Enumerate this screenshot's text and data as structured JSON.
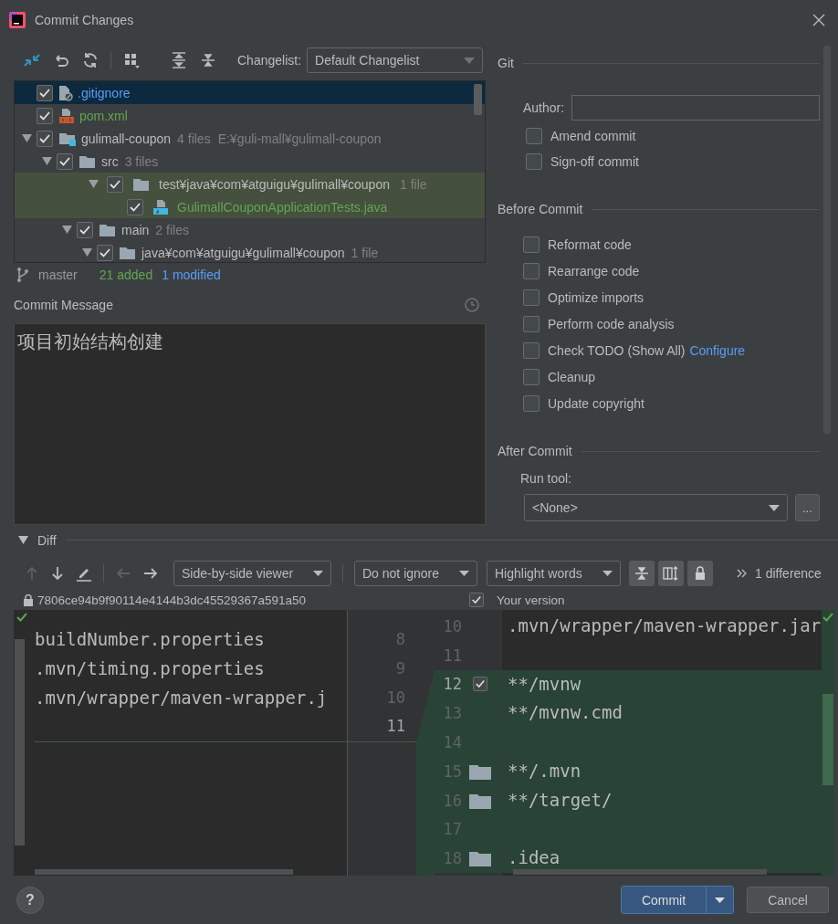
{
  "window": {
    "title": "Commit Changes"
  },
  "changes": {
    "changelist_label": "Changelist:",
    "changelist": "Default Changelist",
    "tree": [
      {
        "kind": "ignore-file",
        "name": ".gitignore",
        "color": "#589df6",
        "checked": true,
        "selected": true,
        "highlighted": false
      },
      {
        "kind": "xml-file",
        "name": "pom.xml",
        "color": "#62a64f",
        "checked": true,
        "selected": false,
        "highlighted": false
      },
      {
        "kind": "module",
        "name": "gulimall-coupon",
        "count": "4 files",
        "path": "E:¥guli-mall¥gulimall-coupon",
        "checked": true,
        "selected": false,
        "highlighted": false,
        "expanded": true,
        "children": [
          {
            "kind": "folder",
            "name": "src",
            "count": "3 files",
            "checked": true,
            "selected": false,
            "highlighted": false,
            "expanded": true,
            "children": [
              {
                "kind": "folder",
                "name": "test¥java¥com¥atguigu¥gulimall¥coupon",
                "count": "1 file",
                "checked": true,
                "selected": false,
                "highlighted": true,
                "expanded": true,
                "children": [
                  {
                    "kind": "java-file",
                    "name": "GulimallCouponApplicationTests.java",
                    "color": "#62a64f",
                    "checked": true,
                    "selected": false,
                    "highlighted": true
                  }
                ]
              },
              {
                "kind": "folder",
                "name": "main",
                "count": "2 files",
                "checked": true,
                "selected": false,
                "highlighted": false,
                "expanded": true,
                "children": [
                  {
                    "kind": "folder",
                    "name": "java¥com¥atguigu¥gulimall¥coupon",
                    "count": "1 file",
                    "checked": true,
                    "selected": false,
                    "highlighted": false,
                    "expanded": true
                  }
                ]
              }
            ]
          }
        ]
      }
    ],
    "branch": "master",
    "added": "21 added",
    "modified": "1 modified"
  },
  "message": {
    "label": "Commit Message",
    "text": "项目初始结构创建"
  },
  "git": {
    "title": "Git",
    "author_label": "Author:",
    "options": [
      {
        "label": "Amend commit",
        "checked": false
      },
      {
        "label": "Sign-off commit",
        "checked": false
      }
    ]
  },
  "before_commit": {
    "title": "Before Commit",
    "options": [
      {
        "label": "Reformat code",
        "checked": false
      },
      {
        "label": "Rearrange code",
        "checked": false
      },
      {
        "label": "Optimize imports",
        "checked": false
      },
      {
        "label": "Perform code analysis",
        "checked": false
      },
      {
        "label": "Check TODO (Show All)",
        "link": "Configure",
        "checked": false
      },
      {
        "label": "Cleanup",
        "checked": false
      },
      {
        "label": "Update copyright",
        "checked": false
      }
    ]
  },
  "after_commit": {
    "title": "After Commit",
    "run_tool_label": "Run tool:",
    "run_tool": "<None>",
    "more_button": "..."
  },
  "diff": {
    "title": "Diff",
    "expanded": true,
    "viewer": "Side-by-side viewer",
    "ignore": "Do not ignore",
    "highlight": "Highlight words",
    "differences": "1 difference",
    "left_revision": "7806ce94b9f90114e4144b3dc45529367a591a50",
    "right_included": true,
    "right_title": "Your version",
    "left_lines": [
      {
        "number": "8",
        "text": "buildNumber.properties"
      },
      {
        "number": "9",
        "text": ".mvn/timing.properties"
      },
      {
        "number": "10",
        "text": ".mvn/wrapper/maven-wrapper.j"
      },
      {
        "number": "11"
      }
    ],
    "right_lines": [
      {
        "kind": "plain",
        "number": "10",
        "text": ".mvn/wrapper/maven-wrapper.jar",
        "changed": false
      },
      {
        "kind": "plain",
        "number": "11",
        "changed": false
      },
      {
        "kind": "checkbox",
        "number": "12",
        "text": "**/mvnw",
        "changed": true,
        "checked": true
      },
      {
        "kind": "plain",
        "number": "13",
        "text": "**/mvnw.cmd",
        "changed": true
      },
      {
        "kind": "plain",
        "number": "14",
        "changed": true
      },
      {
        "kind": "folder",
        "number": "15",
        "text": "**/.mvn",
        "changed": true
      },
      {
        "kind": "folder",
        "number": "16",
        "text": "**/target/",
        "changed": true
      },
      {
        "kind": "plain",
        "number": "17",
        "changed": true
      },
      {
        "kind": "folder",
        "number": "18",
        "text": ".idea",
        "changed": true
      }
    ]
  },
  "footer": {
    "help": "?",
    "commit": "Commit",
    "cancel": "Cancel"
  }
}
